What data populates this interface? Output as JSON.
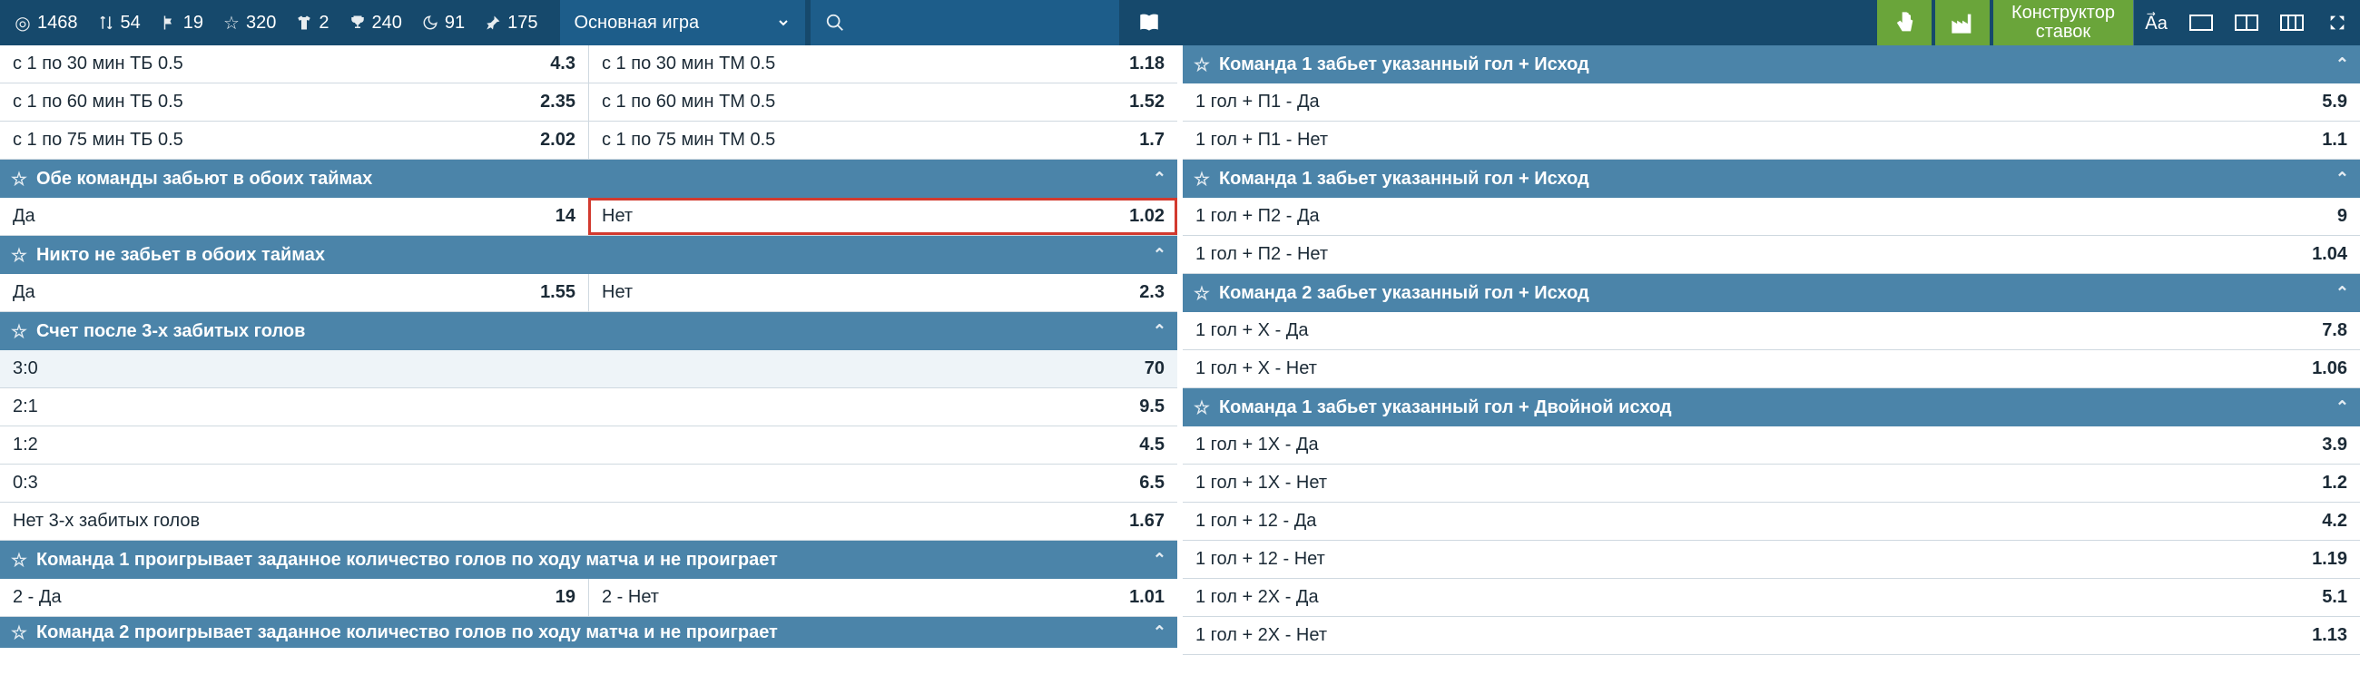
{
  "topbar": {
    "sports": [
      {
        "name": "target",
        "count": "1468"
      },
      {
        "name": "updown",
        "count": "54"
      },
      {
        "name": "flag",
        "count": "19"
      },
      {
        "name": "star",
        "count": "320"
      },
      {
        "name": "shirt",
        "count": "2"
      },
      {
        "name": "trophy",
        "count": "240"
      },
      {
        "name": "moon",
        "count": "91"
      },
      {
        "name": "pin",
        "count": "175"
      }
    ],
    "mode": "Основная игра",
    "constructor_l1": "Конструктор",
    "constructor_l2": "ставок"
  },
  "left": {
    "top_pairs": [
      {
        "a": {
          "label": "с 1 по 30 мин ТБ 0.5",
          "odd": "4.3"
        },
        "b": {
          "label": "с 1 по 30 мин ТМ 0.5",
          "odd": "1.18"
        }
      },
      {
        "a": {
          "label": "с 1 по 60 мин ТБ 0.5",
          "odd": "2.35"
        },
        "b": {
          "label": "с 1 по 60 мин ТМ 0.5",
          "odd": "1.52"
        }
      },
      {
        "a": {
          "label": "с 1 по 75 мин ТБ 0.5",
          "odd": "2.02"
        },
        "b": {
          "label": "с 1 по 75 мин ТМ 0.5",
          "odd": "1.7"
        }
      }
    ],
    "m1": {
      "title": "Обе команды забьют в обоих таймах",
      "rows": [
        {
          "a": {
            "label": "Да",
            "odd": "14"
          },
          "b": {
            "label": "Нет",
            "odd": "1.02",
            "hl": true
          }
        }
      ]
    },
    "m2": {
      "title": "Никто не забьет в обоих таймах",
      "rows": [
        {
          "a": {
            "label": "Да",
            "odd": "1.55"
          },
          "b": {
            "label": "Нет",
            "odd": "2.3"
          }
        }
      ]
    },
    "m3": {
      "title": "Счет после 3-х забитых голов",
      "full": [
        {
          "label": "3:0",
          "odd": "70",
          "alt": true
        },
        {
          "label": "2:1",
          "odd": "9.5"
        },
        {
          "label": "1:2",
          "odd": "4.5"
        },
        {
          "label": "0:3",
          "odd": "6.5"
        },
        {
          "label": "Нет 3-х забитых голов",
          "odd": "1.67"
        }
      ]
    },
    "m4": {
      "title": "Команда 1 проигрывает заданное количество голов по ходу матча и не проиграет",
      "rows": [
        {
          "a": {
            "label": "2 - Да",
            "odd": "19"
          },
          "b": {
            "label": "2 - Нет",
            "odd": "1.01"
          }
        }
      ]
    },
    "m5": {
      "title": "Команда 2 проигрывает заданное количество голов по ходу матча и не проиграет"
    }
  },
  "right": {
    "m1": {
      "title": "Команда 1 забьет указанный гол + Исход",
      "full": [
        {
          "label": "1 гол + П1 - Да",
          "odd": "5.9"
        },
        {
          "label": "1 гол + П1 - Нет",
          "odd": "1.1"
        }
      ]
    },
    "m2": {
      "title": "Команда 1 забьет указанный гол + Исход",
      "full": [
        {
          "label": "1 гол + П2 - Да",
          "odd": "9"
        },
        {
          "label": "1 гол + П2 - Нет",
          "odd": "1.04"
        }
      ]
    },
    "m3": {
      "title": "Команда 2 забьет указанный гол + Исход",
      "full": [
        {
          "label": "1 гол + X - Да",
          "odd": "7.8"
        },
        {
          "label": "1 гол + X - Нет",
          "odd": "1.06"
        }
      ]
    },
    "m4": {
      "title": "Команда 1 забьет указанный гол + Двойной исход",
      "full": [
        {
          "label": "1 гол + 1X - Да",
          "odd": "3.9"
        },
        {
          "label": "1 гол + 1X - Нет",
          "odd": "1.2"
        },
        {
          "label": "1 гол + 12 - Да",
          "odd": "4.2"
        },
        {
          "label": "1 гол + 12 - Нет",
          "odd": "1.19"
        },
        {
          "label": "1 гол + 2X - Да",
          "odd": "5.1"
        },
        {
          "label": "1 гол + 2X - Нет",
          "odd": "1.13"
        }
      ]
    }
  }
}
